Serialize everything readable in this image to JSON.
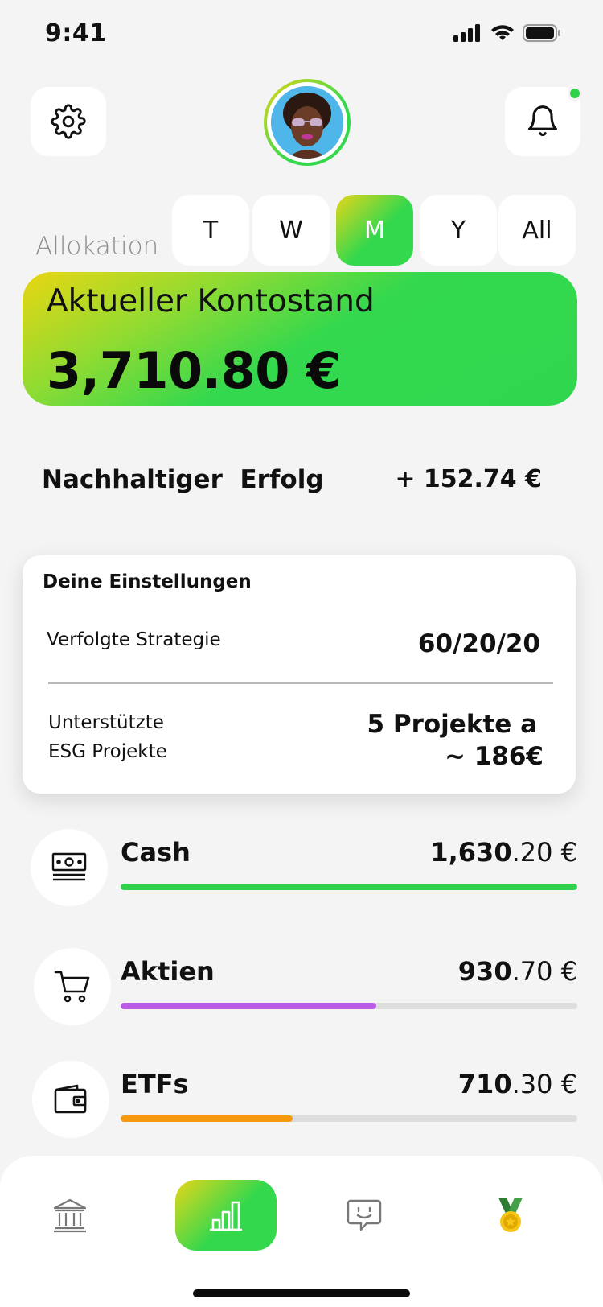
{
  "status_bar": {
    "time": "9:41"
  },
  "header": {
    "settings_icon": "gear-icon",
    "bell_icon": "bell-icon",
    "notification_dot_color": "#2fd14a"
  },
  "period_selector": {
    "label": "Allokation",
    "tabs": [
      {
        "label": "T",
        "active": false
      },
      {
        "label": "W",
        "active": false
      },
      {
        "label": "M",
        "active": true
      },
      {
        "label": "Y",
        "active": false
      },
      {
        "label": "All",
        "active": false
      }
    ]
  },
  "balance": {
    "title": "Aktueller Kontostand",
    "value": "3,710.80 €"
  },
  "success": {
    "label": "Nachhaltiger  Erfolg",
    "value": "+ 152.74 €"
  },
  "settings_card": {
    "title": "Deine Einstellungen",
    "strategy_label": "Verfolgte Strategie",
    "strategy_value": "60/20/20",
    "esg_label_line1": "Unterstützte",
    "esg_label_line2": "ESG Projekte",
    "esg_value_line1": "5 Projekte a",
    "esg_value_line2": "~ 186€"
  },
  "allocations": [
    {
      "name": "Cash",
      "amount_int": "1,630",
      "amount_dec": ".20 €",
      "icon": "banknote-icon",
      "color": "#2fd14a",
      "share": 1.0
    },
    {
      "name": "Aktien",
      "amount_int": "930",
      "amount_dec": ".70 €",
      "icon": "shopping-cart-icon",
      "color": "#bb5be8",
      "share": 0.56
    },
    {
      "name": "ETFs",
      "amount_int": "710",
      "amount_dec": ".30 €",
      "icon": "wallet-icon",
      "color": "#f7990f",
      "share": 0.376
    }
  ],
  "bottom_nav": {
    "items": [
      {
        "icon": "bank-icon",
        "active": false
      },
      {
        "icon": "bar-chart-icon",
        "active": true
      },
      {
        "icon": "chat-bot-icon",
        "active": false
      },
      {
        "icon": "medal-icon",
        "active": false
      }
    ]
  }
}
